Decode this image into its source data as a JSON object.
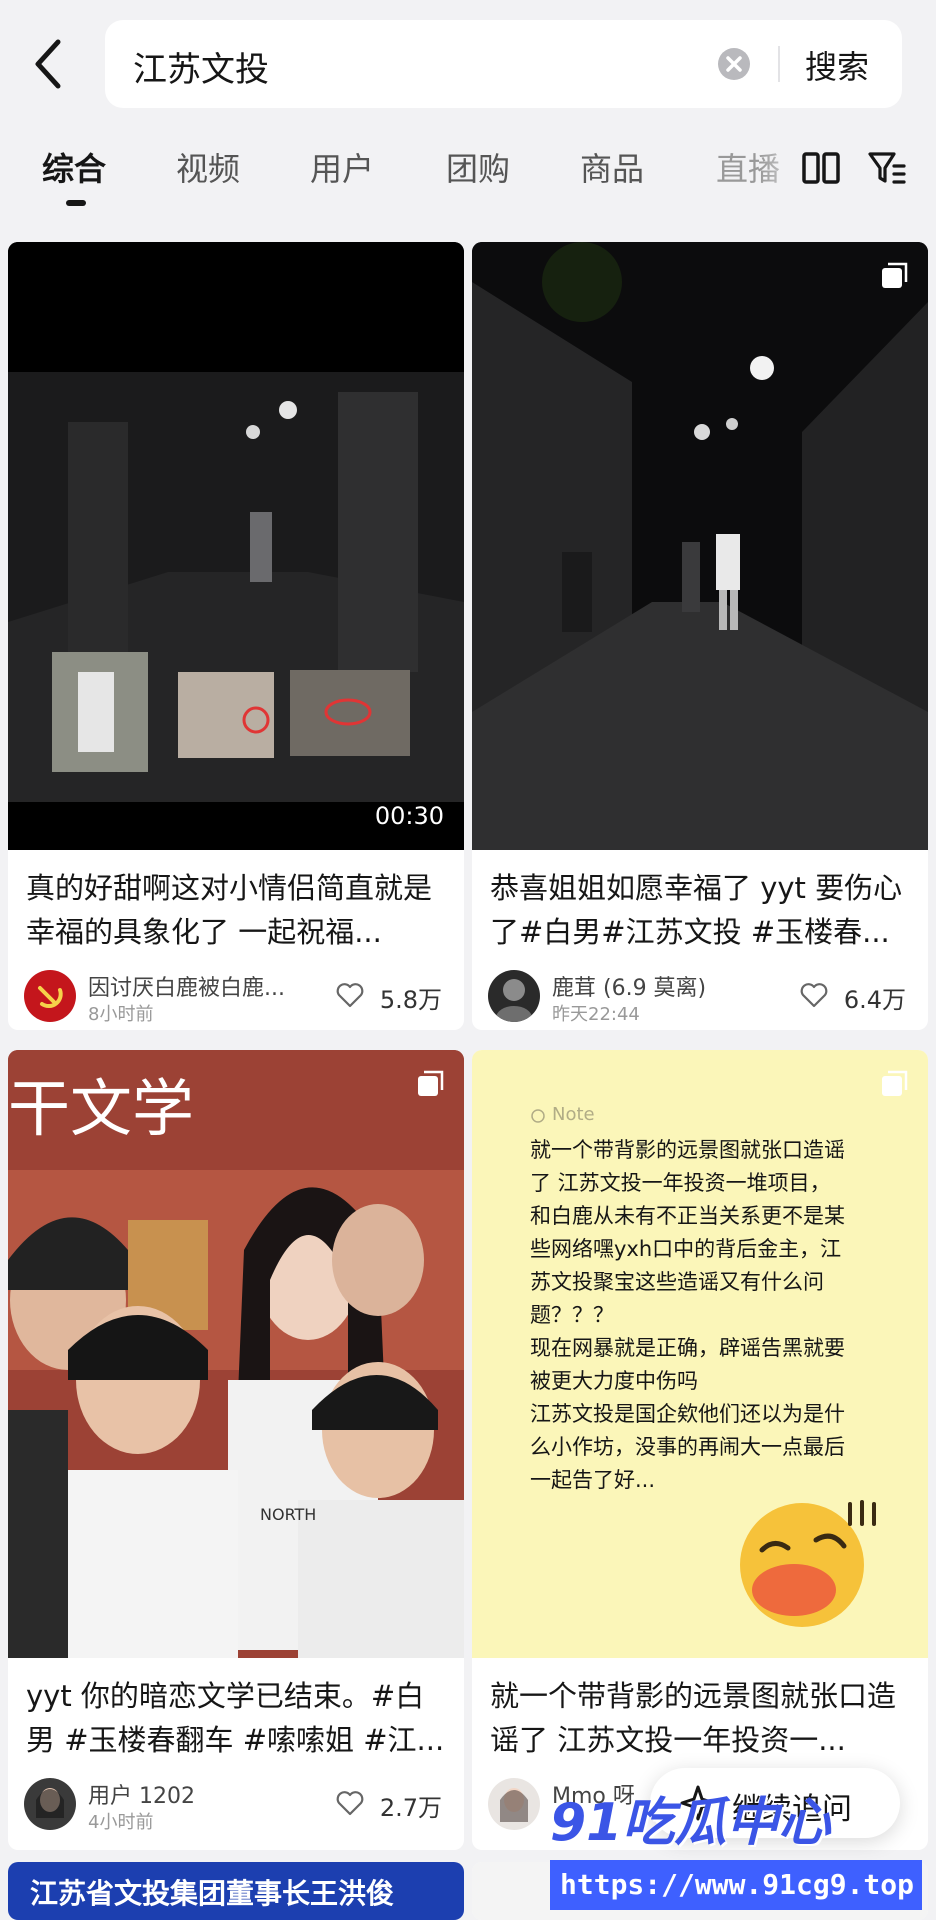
{
  "header": {
    "query": "江苏文投",
    "search_label": "搜索"
  },
  "tabs": [
    {
      "label": "综合",
      "active": true
    },
    {
      "label": "视频"
    },
    {
      "label": "用户"
    },
    {
      "label": "团购"
    },
    {
      "label": "商品"
    },
    {
      "label": "直播"
    }
  ],
  "cards": [
    {
      "caption": "真的好甜啊这对小情侣简直就是幸福的具象化了 一起祝福...",
      "author": "因讨厌白鹿被白鹿...",
      "time": "8小时前",
      "likes": "5.8万",
      "duration": "00:30"
    },
    {
      "caption": "恭喜姐姐如愿幸福了 yyt 要伤心了#白男#江苏文投 #玉楼春...",
      "author": "鹿茸 (6.9 莫离)",
      "time": "昨天22:44",
      "likes": "6.4万"
    },
    {
      "caption": "yyt 你的暗恋文学已结束。#白男 #玉楼春翻车 #嗦嗦姐 #江...",
      "author": "用户 1202",
      "time": "4小时前",
      "likes": "2.7万",
      "image_text": "干文学",
      "shirt_text": "NORTH"
    },
    {
      "caption": "就一个带背影的远景图就张口造谣了 江苏文投一年投资一...",
      "author": "Mmo 呀",
      "note_tag": "Note",
      "note_lines": [
        "就一个带背影的远景图就张口造谣",
        "了 江苏文投一年投资一堆项目，",
        "和白鹿从未有不正当关系更不是某",
        "些网络嘿yxh口中的背后金主，江",
        "苏文投聚宝这些造谣又有什么问",
        "题？？？",
        "现在网暴就是正确，辟谣告黑就要",
        "被更大力度中伤吗",
        "江苏文投是国企欸他们还以为是什",
        "么小作坊，没事的再闹大一点最后",
        "一起告了好..."
      ]
    },
    {
      "image_text": "江苏省文投集团董事长王洪俊"
    }
  ],
  "float_button": {
    "label": "继续追问"
  },
  "watermark": {
    "brand": "91吃瓜中心",
    "url": "https://www.91cg9.top"
  }
}
